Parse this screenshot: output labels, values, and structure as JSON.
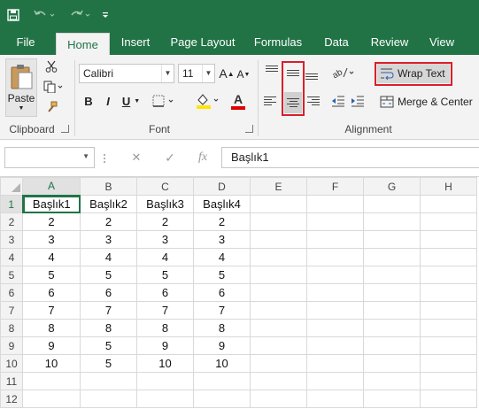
{
  "colors": {
    "brand": "#217346",
    "highlight": "#d9202a",
    "fill_yellow": "#ffe600",
    "font_red": "#e00000"
  },
  "quick_access": {
    "save_icon": "save-icon",
    "undo_icon": "undo-icon",
    "redo_icon": "redo-icon",
    "customize_icon": "customize-icon"
  },
  "tabs": [
    "File",
    "Home",
    "Insert",
    "Page Layout",
    "Formulas",
    "Data",
    "Review",
    "View"
  ],
  "active_tab": "Home",
  "clipboard": {
    "paste_label": "Paste",
    "group_label": "Clipboard"
  },
  "font": {
    "name": "Calibri",
    "size": "11",
    "grow_label": "A",
    "shrink_label": "A",
    "bold": "B",
    "italic": "I",
    "underline": "U",
    "font_color_label": "A",
    "group_label": "Font"
  },
  "alignment": {
    "wrap_text": "Wrap Text",
    "merge_center": "Merge & Center",
    "group_label": "Alignment"
  },
  "formula_bar": {
    "name_box": "",
    "cancel": "✕",
    "enter": "✓",
    "fx": "fx",
    "content": "Başlık1"
  },
  "columns": [
    "A",
    "B",
    "C",
    "D",
    "E",
    "F",
    "G",
    "H"
  ],
  "rows": [
    [
      "Başlık1",
      "Başlık2",
      "Başlık3",
      "Başlık4",
      "",
      "",
      "",
      ""
    ],
    [
      "2",
      "2",
      "2",
      "2",
      "",
      "",
      "",
      ""
    ],
    [
      "3",
      "3",
      "3",
      "3",
      "",
      "",
      "",
      ""
    ],
    [
      "4",
      "4",
      "4",
      "4",
      "",
      "",
      "",
      ""
    ],
    [
      "5",
      "5",
      "5",
      "5",
      "",
      "",
      "",
      ""
    ],
    [
      "6",
      "6",
      "6",
      "6",
      "",
      "",
      "",
      ""
    ],
    [
      "7",
      "7",
      "7",
      "7",
      "",
      "",
      "",
      ""
    ],
    [
      "8",
      "8",
      "8",
      "8",
      "",
      "",
      "",
      ""
    ],
    [
      "9",
      "5",
      "9",
      "9",
      "",
      "",
      "",
      ""
    ],
    [
      "10",
      "5",
      "10",
      "10",
      "",
      "",
      "",
      ""
    ],
    [
      "",
      "",
      "",
      "",
      "",
      "",
      "",
      ""
    ],
    [
      "",
      "",
      "",
      "",
      "",
      "",
      "",
      ""
    ]
  ]
}
